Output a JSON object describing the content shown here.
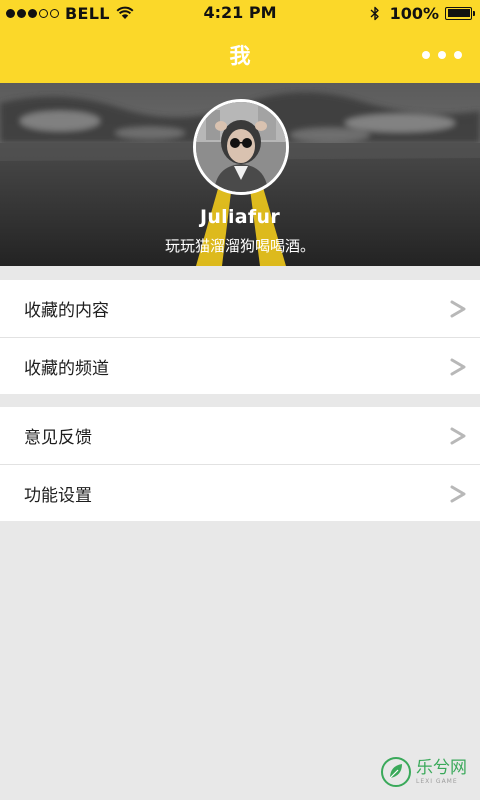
{
  "status_bar": {
    "carrier": "BELL",
    "time": "4:21 PM",
    "battery": "100%",
    "battery_level": 1.0,
    "signal_dots_filled": 3,
    "signal_dots_total": 5,
    "icons": [
      "signal-dots-icon",
      "wifi-icon",
      "bluetooth-icon",
      "battery-icon"
    ]
  },
  "nav": {
    "title": "我",
    "more_icon": "more-dots-icon"
  },
  "profile": {
    "username": "Juliafur",
    "bio": "玩玩猫溜溜狗喝喝酒。"
  },
  "menu_groups": [
    {
      "items": [
        {
          "label": "收藏的内容"
        },
        {
          "label": "收藏的频道"
        }
      ]
    },
    {
      "items": [
        {
          "label": "意见反馈"
        },
        {
          "label": "功能设置"
        }
      ]
    }
  ],
  "watermark": {
    "text": "乐兮网",
    "subtext": "LEXI GAME"
  },
  "colors": {
    "accent_yellow": "#fbd829",
    "background": "#e8e8e8",
    "row_background": "#ffffff",
    "chevron": "#b8b8b8",
    "watermark_green": "#3aa95a"
  }
}
